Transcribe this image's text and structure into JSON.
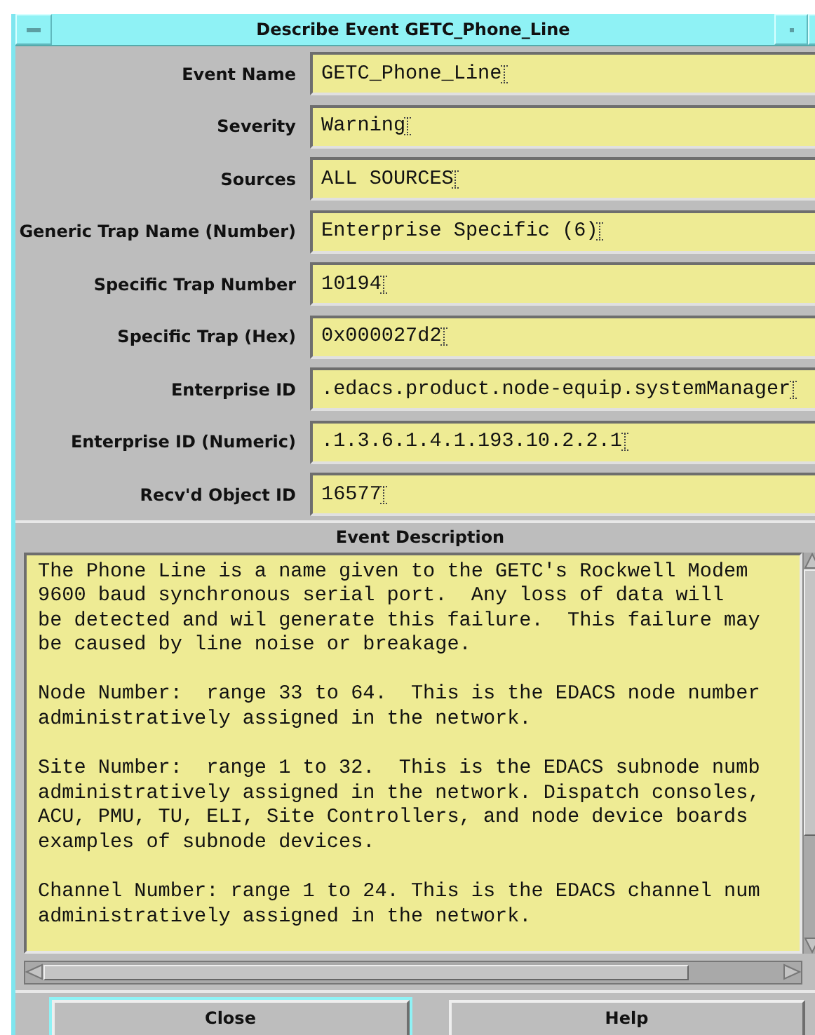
{
  "window": {
    "title": "Describe Event GETC_Phone_Line"
  },
  "fields": [
    {
      "label": "Event Name",
      "value": "GETC_Phone_Line"
    },
    {
      "label": "Severity",
      "value": "Warning"
    },
    {
      "label": "Sources",
      "value": "ALL SOURCES"
    },
    {
      "label": "Generic Trap Name (Number)",
      "value": "Enterprise Specific (6)"
    },
    {
      "label": "Specific Trap Number",
      "value": "10194"
    },
    {
      "label": "Specific Trap (Hex)",
      "value": "0x000027d2"
    },
    {
      "label": "Enterprise ID",
      "value": ".edacs.product.node-equip.systemManager"
    },
    {
      "label": "Enterprise ID (Numeric)",
      "value": ".1.3.6.1.4.1.193.10.2.2.1"
    },
    {
      "label": "Recv'd Object ID",
      "value": "16577"
    }
  ],
  "description": {
    "heading": "Event Description",
    "paragraphs": [
      "The Phone Line is a name given to the GETC's Rockwell Modem\n9600 baud synchronous serial port.  Any loss of data will\nbe detected and wil generate this failure.  This failure may\nbe caused by line noise or breakage.",
      "Node Number:  range 33 to 64.  This is the EDACS node number\nadministratively assigned in the network.",
      "Site Number:  range 1 to 32.  This is the EDACS subnode numb\nadministratively assigned in the network. Dispatch consoles,\nACU, PMU, TU, ELI, Site Controllers, and node device boards\nexamples of subnode devices.",
      "Channel Number: range 1 to 24. This is the EDACS channel num\nadministratively assigned in the network."
    ]
  },
  "buttons": [
    {
      "label": "Close",
      "default": true
    },
    {
      "label": "Help",
      "default": false
    }
  ]
}
